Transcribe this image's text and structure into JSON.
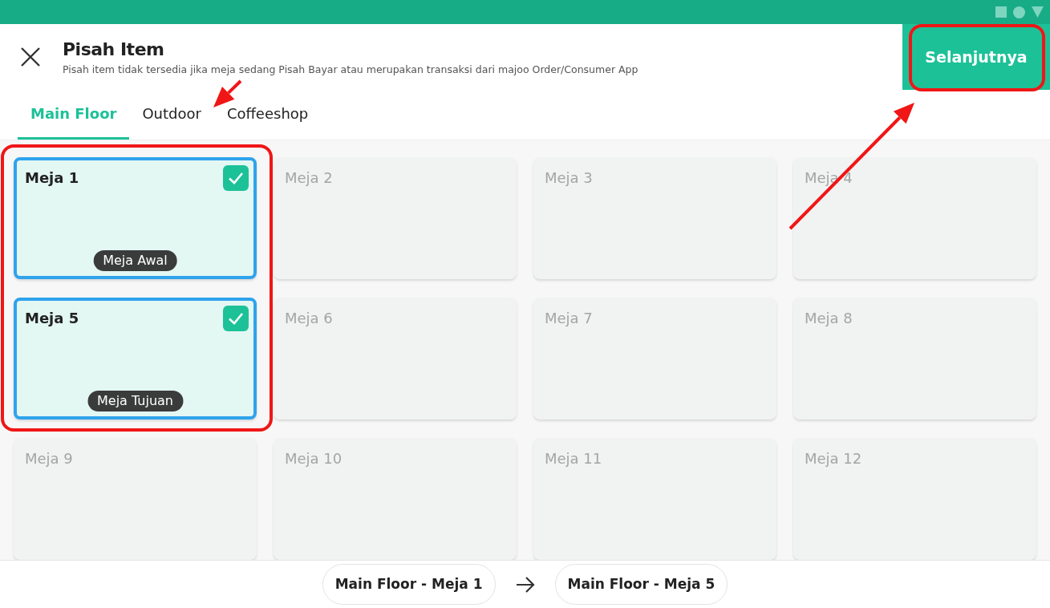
{
  "header": {
    "title": "Pisah Item",
    "subtitle": "Pisah item tidak tersedia jika meja sedang Pisah Bayar atau merupakan transaksi dari majoo Order/Consumer App",
    "next_button": "Selanjutnya"
  },
  "tabs": [
    {
      "label": "Main Floor",
      "selected": true
    },
    {
      "label": "Outdoor",
      "selected": false
    },
    {
      "label": "Coffeeshop",
      "selected": false
    }
  ],
  "tables": [
    {
      "label": "Meja 1",
      "selected": true,
      "tag": "Meja Awal"
    },
    {
      "label": "Meja 2",
      "selected": false
    },
    {
      "label": "Meja 3",
      "selected": false
    },
    {
      "label": "Meja 4",
      "selected": false
    },
    {
      "label": "Meja 5",
      "selected": true,
      "tag": "Meja Tujuan"
    },
    {
      "label": "Meja 6",
      "selected": false
    },
    {
      "label": "Meja 7",
      "selected": false
    },
    {
      "label": "Meja 8",
      "selected": false
    },
    {
      "label": "Meja 9",
      "selected": false
    },
    {
      "label": "Meja 10",
      "selected": false
    },
    {
      "label": "Meja 11",
      "selected": false
    },
    {
      "label": "Meja 12",
      "selected": false
    }
  ],
  "summary": {
    "from": "Main Floor - Meja 1",
    "to": "Main Floor - Meja 5"
  },
  "annotations": [
    {
      "kind": "frame"
    },
    {
      "kind": "frame"
    },
    {
      "kind": "arrow"
    },
    {
      "kind": "arrow"
    }
  ]
}
